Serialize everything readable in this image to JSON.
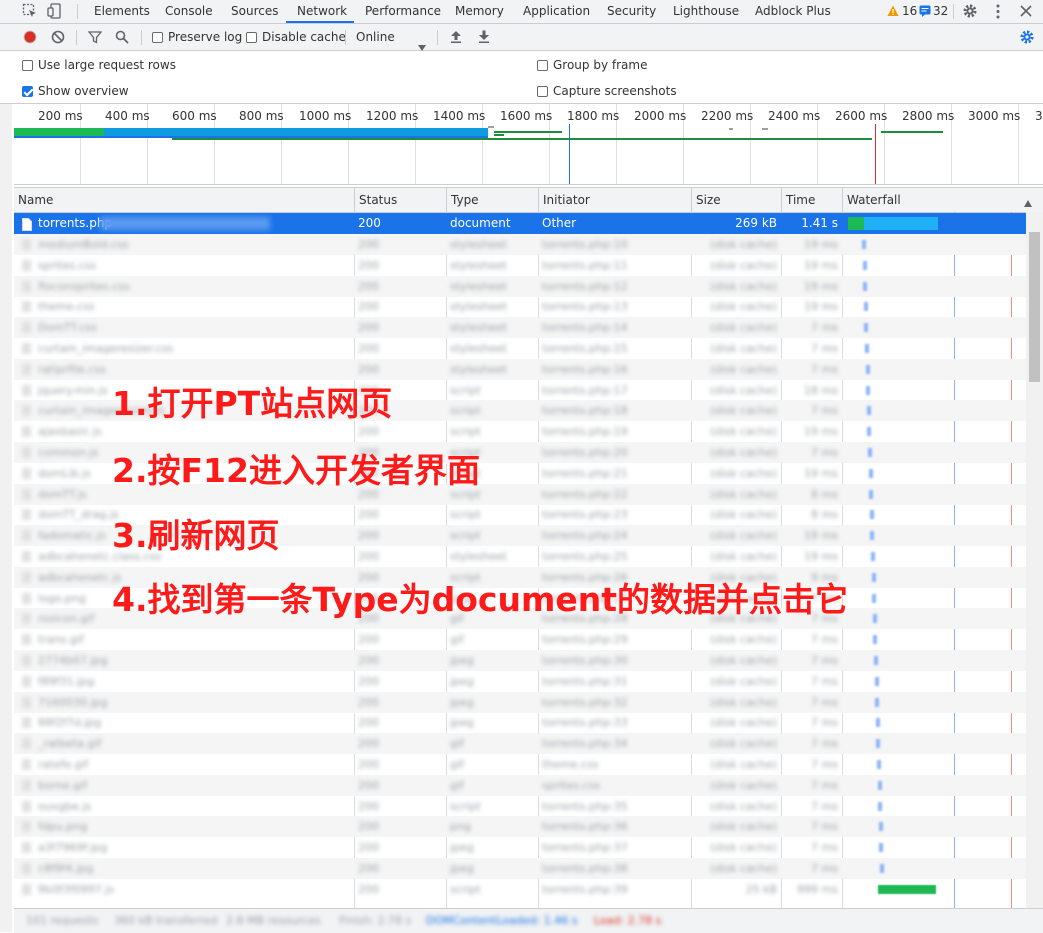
{
  "tabs": [
    "Elements",
    "Console",
    "Sources",
    "Network",
    "Performance",
    "Memory",
    "Application",
    "Security",
    "Lighthouse",
    "Adblock Plus"
  ],
  "active_tab": "Network",
  "warnings_count": "16",
  "messages_count": "32",
  "toolbar": {
    "preserve_log": "Preserve log",
    "disable_cache": "Disable cache",
    "throttle": "Online"
  },
  "settings": {
    "large_rows": "Use large request rows",
    "show_overview": "Show overview",
    "group_by_frame": "Group by frame",
    "capture_screenshots": "Capture screenshots"
  },
  "overview_ticks": [
    "200 ms",
    "400 ms",
    "600 ms",
    "800 ms",
    "1000 ms",
    "1200 ms",
    "1400 ms",
    "1600 ms",
    "1800 ms",
    "2000 ms",
    "2200 ms",
    "2400 ms",
    "2600 ms",
    "2800 ms",
    "3000 ms",
    "3"
  ],
  "columns": [
    "Name",
    "Status",
    "Type",
    "Initiator",
    "Size",
    "Time",
    "Waterfall"
  ],
  "selected_row": {
    "name": "torrents.php",
    "status": "200",
    "type": "document",
    "initiator": "Other",
    "size": "269 kB",
    "time": "1.41 s"
  },
  "blurred_rows": [
    {
      "name": "mediumBold.css",
      "status": "200",
      "type": "stylesheet",
      "initiator": "torrents.php:10",
      "size": "(disk cache)",
      "time": "19 ms"
    },
    {
      "name": "sprites.css",
      "status": "200",
      "type": "stylesheet",
      "initiator": "torrents.php:11",
      "size": "(disk cache)",
      "time": "19 ms"
    },
    {
      "name": "floconsprites.css",
      "status": "200",
      "type": "stylesheet",
      "initiator": "torrents.php:12",
      "size": "(disk cache)",
      "time": "19 ms"
    },
    {
      "name": "theme.css",
      "status": "200",
      "type": "stylesheet",
      "initiator": "torrents.php:13",
      "size": "(disk cache)",
      "time": "19 ms"
    },
    {
      "name": "DomTT.css",
      "status": "200",
      "type": "stylesheet",
      "initiator": "torrents.php:14",
      "size": "(disk cache)",
      "time": "7 ms"
    },
    {
      "name": "curtain_imageresizer.css",
      "status": "200",
      "type": "stylesheet",
      "initiator": "torrents.php:15",
      "size": "(disk cache)",
      "time": "7 ms"
    },
    {
      "name": "ratiprfile.css",
      "status": "200",
      "type": "stylesheet",
      "initiator": "torrents.php:16",
      "size": "(disk cache)",
      "time": "7 ms"
    },
    {
      "name": "jquery.min.js",
      "status": "200",
      "type": "script",
      "initiator": "torrents.php:17",
      "size": "(disk cache)",
      "time": "18 ms"
    },
    {
      "name": "curtain_imageresizer.js",
      "status": "200",
      "type": "script",
      "initiator": "torrents.php:18",
      "size": "(disk cache)",
      "time": "7 ms"
    },
    {
      "name": "ajaxbasic.js",
      "status": "200",
      "type": "script",
      "initiator": "torrents.php:19",
      "size": "(disk cache)",
      "time": "19 ms"
    },
    {
      "name": "common.js",
      "status": "200",
      "type": "script",
      "initiator": "torrents.php:20",
      "size": "(disk cache)",
      "time": "7 ms"
    },
    {
      "name": "domLib.js",
      "status": "200",
      "type": "script",
      "initiator": "torrents.php:21",
      "size": "(disk cache)",
      "time": "19 ms"
    },
    {
      "name": "domTT.js",
      "status": "200",
      "type": "script",
      "initiator": "torrents.php:22",
      "size": "(disk cache)",
      "time": "8 ms"
    },
    {
      "name": "domTT_drag.js",
      "status": "200",
      "type": "script",
      "initiator": "torrents.php:23",
      "size": "(disk cache)",
      "time": "8 ms"
    },
    {
      "name": "fadomatic.js",
      "status": "200",
      "type": "script",
      "initiator": "torrents.php:24",
      "size": "(disk cache)",
      "time": "19 ms"
    },
    {
      "name": "adbcahenetc.class.css",
      "status": "200",
      "type": "stylesheet",
      "initiator": "torrents.php:25",
      "size": "(disk cache)",
      "time": "19 ms"
    },
    {
      "name": "adbcahenetc.js",
      "status": "200",
      "type": "script",
      "initiator": "torrents.php:26",
      "size": "(disk cache)",
      "time": "9 ms"
    },
    {
      "name": "logo.png",
      "status": "200",
      "type": "png",
      "initiator": "torrents.php:27",
      "size": "(disk cache)",
      "time": "7 ms"
    },
    {
      "name": "rssicon.gif",
      "status": "200",
      "type": "gif",
      "initiator": "torrents.php:28",
      "size": "(disk cache)",
      "time": "7 ms"
    },
    {
      "name": "trans.gif",
      "status": "200",
      "type": "gif",
      "initiator": "torrents.php:29",
      "size": "(disk cache)",
      "time": "7 ms"
    },
    {
      "name": "2774b07.jpg",
      "status": "200",
      "type": "jpeg",
      "initiator": "torrents.php:30",
      "size": "(disk cache)",
      "time": "7 ms"
    },
    {
      "name": "f89f31.jpg",
      "status": "200",
      "type": "jpeg",
      "initiator": "torrents.php:31",
      "size": "(disk cache)",
      "time": "7 ms"
    },
    {
      "name": "7160030.jpg",
      "status": "200",
      "type": "jpeg",
      "initiator": "torrents.php:32",
      "size": "(disk cache)",
      "time": "7 ms"
    },
    {
      "name": "88f2f7d.jpg",
      "status": "200",
      "type": "jpeg",
      "initiator": "torrents.php:33",
      "size": "(disk cache)",
      "time": "7 ms"
    },
    {
      "name": "_ratbeta.gif",
      "status": "200",
      "type": "gif",
      "initiator": "torrents.php:34",
      "size": "(disk cache)",
      "time": "7 ms"
    },
    {
      "name": "ratefe.gif",
      "status": "200",
      "type": "gif",
      "initiator": "theme.css",
      "size": "(disk cache)",
      "time": "7 ms"
    },
    {
      "name": "borne.gif",
      "status": "200",
      "type": "gif",
      "initiator": "sprites.css",
      "size": "(disk cache)",
      "time": "7 ms"
    },
    {
      "name": "ouvgbe.js",
      "status": "200",
      "type": "script",
      "initiator": "torrents.php:35",
      "size": "(disk cache)",
      "time": "7 ms"
    },
    {
      "name": "fdpu.png",
      "status": "200",
      "type": "png",
      "initiator": "torrents.php:36",
      "size": "(disk cache)",
      "time": "7 ms"
    },
    {
      "name": "a3f7969f.jpg",
      "status": "200",
      "type": "jpeg",
      "initiator": "torrents.php:37",
      "size": "(disk cache)",
      "time": "7 ms"
    },
    {
      "name": "c8f9f4.jpg",
      "status": "200",
      "type": "jpeg",
      "initiator": "torrents.php:38",
      "size": "(disk cache)",
      "time": "7 ms"
    },
    {
      "name": "9b0f3f0997.js",
      "status": "200",
      "type": "script",
      "initiator": "torrents.php:39",
      "size": "25 kB",
      "time": "999 ms"
    }
  ],
  "status_bar": [
    "101 requests",
    "360 kB transferred",
    "2.8 MB resources",
    "Finish: 2.78 s",
    "DOMContentLoaded: 1.46 s",
    "Load: 2.78 s"
  ],
  "annotations": [
    "1.打开PT站点网页",
    "2.按F12进入开发者界面",
    "3.刷新网页",
    "4.找到第一条Type为document的数据并点击它"
  ]
}
